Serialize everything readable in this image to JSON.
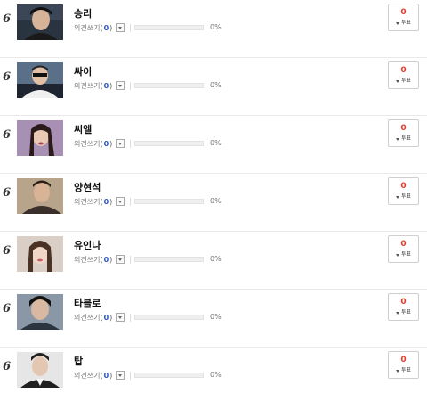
{
  "rows": [
    {
      "rank": "6",
      "name": "승리",
      "opinion_label": "의견쓰기",
      "count": "0",
      "percent": "0%",
      "progress": 0,
      "vote_count": "0",
      "vote_label": "투표"
    },
    {
      "rank": "6",
      "name": "싸이",
      "opinion_label": "의견쓰기",
      "count": "0",
      "percent": "0%",
      "progress": 0,
      "vote_count": "0",
      "vote_label": "투표"
    },
    {
      "rank": "6",
      "name": "씨엘",
      "opinion_label": "의견쓰기",
      "count": "0",
      "percent": "0%",
      "progress": 0,
      "vote_count": "0",
      "vote_label": "투표"
    },
    {
      "rank": "6",
      "name": "양현석",
      "opinion_label": "의견쓰기",
      "count": "0",
      "percent": "0%",
      "progress": 0,
      "vote_count": "0",
      "vote_label": "투표"
    },
    {
      "rank": "6",
      "name": "유인나",
      "opinion_label": "의견쓰기",
      "count": "0",
      "percent": "0%",
      "progress": 0,
      "vote_count": "0",
      "vote_label": "투표"
    },
    {
      "rank": "6",
      "name": "타블로",
      "opinion_label": "의견쓰기",
      "count": "0",
      "percent": "0%",
      "progress": 0,
      "vote_count": "0",
      "vote_label": "투표"
    },
    {
      "rank": "6",
      "name": "탑",
      "opinion_label": "의견쓰기",
      "count": "0",
      "percent": "0%",
      "progress": 0,
      "vote_count": "0",
      "vote_label": "투표"
    }
  ]
}
